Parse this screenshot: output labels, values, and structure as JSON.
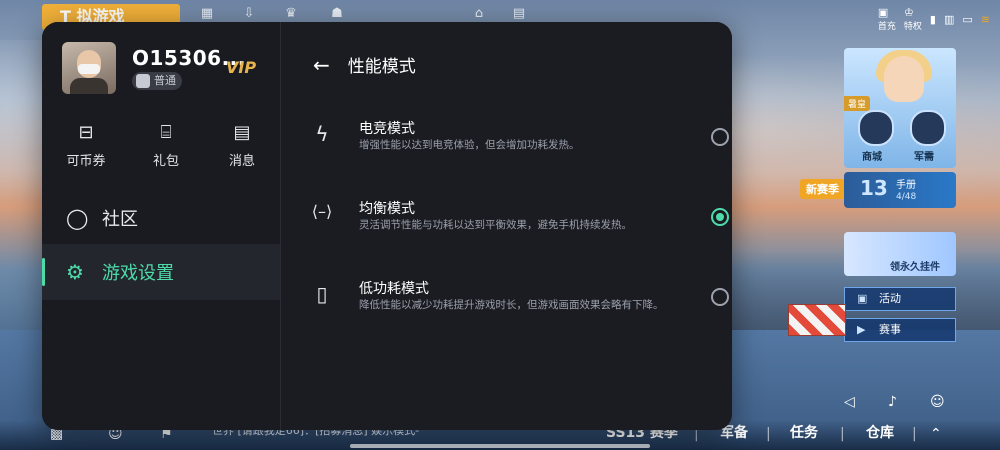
{
  "background": {
    "ribbon_text": "T 拟游戏",
    "top_labels": [
      "首充",
      "特权"
    ],
    "char_card": {
      "tag": "暑皇",
      "shop_label": "商城",
      "supply_label": "军需"
    },
    "season": {
      "tag": "新赛季",
      "number": "13",
      "title": "手册",
      "progress": "4/48"
    },
    "permanent_label": "领永久挂件",
    "activity_label": "活动",
    "event_label": "赛事"
  },
  "bottom_bar": {
    "chat": "世界 [请跟我走66]：[招募消息] 娱乐模式-",
    "season_label": "SS13 赛季",
    "items": [
      "军备",
      "任务",
      "仓库"
    ]
  },
  "panel": {
    "profile": {
      "name": "O15306...",
      "vip": "VIP",
      "level": "普通"
    },
    "quick_actions": [
      {
        "label": "可币券",
        "icon": "ticket-icon"
      },
      {
        "label": "礼包",
        "icon": "gift-icon"
      },
      {
        "label": "消息",
        "icon": "message-icon"
      }
    ],
    "menu": {
      "community": "社区",
      "game_settings": "游戏设置"
    },
    "performance": {
      "title": "性能模式",
      "modes": [
        {
          "title": "电竞模式",
          "desc": "增强性能以达到电竞体验，但会增加功耗发热。",
          "selected": false
        },
        {
          "title": "均衡模式",
          "desc": "灵活调节性能与功耗以达到平衡效果，避免手机持续发热。",
          "selected": true
        },
        {
          "title": "低功耗模式",
          "desc": "降低性能以减少功耗提升游戏时长，但游戏画面效果会略有下降。",
          "selected": false
        }
      ]
    }
  },
  "colors": {
    "accent": "#4ddba9",
    "panel_bg": "#1b1c22",
    "vip": "#e7b34c"
  }
}
